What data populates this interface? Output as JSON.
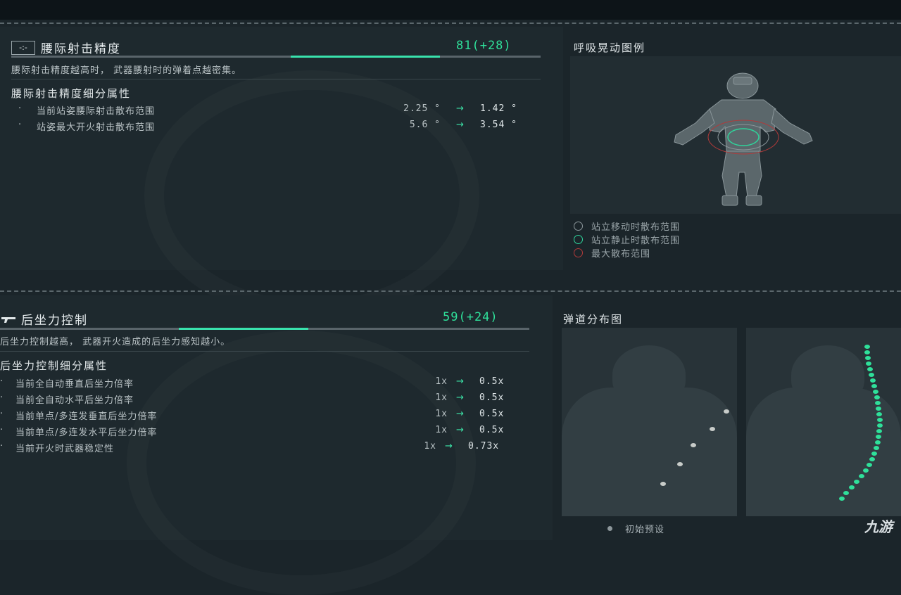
{
  "section1": {
    "icon": "crosshair-icon",
    "title": "腰际射击精度",
    "score": "81(+28)",
    "progress": {
      "base": 0.5,
      "boosted": 0.81
    },
    "description": "腰际射击精度越高时， 武器腰射时的弹着点越密集。",
    "subtitle": "腰际射击精度细分属性",
    "rows": [
      {
        "bullet": "·",
        "label": "当前站姿腰际射击散布范围",
        "old": "2.25 °",
        "arrow": "→",
        "new": "1.42 °"
      },
      {
        "bullet": "·",
        "label": "站姿最大开火射击散布范围",
        "old": "5.6 °",
        "arrow": "→",
        "new": "3.54 °"
      }
    ]
  },
  "breath_panel": {
    "title": "呼吸晃动图例",
    "figure": "soldier-figure",
    "legend": [
      {
        "label": "站立移动时散布范围",
        "color": "#8c979b"
      },
      {
        "label": "站立静止时散布范围",
        "color": "#2fd49b"
      },
      {
        "label": "最大散布范围",
        "color": "#b23a3a"
      }
    ]
  },
  "section2": {
    "icon": "rifle-icon",
    "title": "后坐力控制",
    "score": "59(+24)",
    "progress": {
      "base": 0.35,
      "boosted": 0.59
    },
    "description": "后坐力控制越高， 武器开火造成的后坐力感知越小。",
    "subtitle": "后坐力控制细分属性",
    "rows": [
      {
        "bullet": "·",
        "label": "当前全自动垂直后坐力倍率",
        "old": "1x",
        "arrow": "→",
        "new": "0.5x"
      },
      {
        "bullet": "·",
        "label": "当前全自动水平后坐力倍率",
        "old": "1x",
        "arrow": "→",
        "new": "0.5x"
      },
      {
        "bullet": "·",
        "label": "当前单点/多连发垂直后坐力倍率",
        "old": "1x",
        "arrow": "→",
        "new": "0.5x"
      },
      {
        "bullet": "·",
        "label": "当前单点/多连发水平后坐力倍率",
        "old": "1x",
        "arrow": "→",
        "new": "0.5x"
      },
      {
        "bullet": "·",
        "label": "当前开火时武器稳定性",
        "old": "1x",
        "arrow": "→",
        "new": "0.73x"
      }
    ]
  },
  "trajectory_panel": {
    "title": "弹道分布图",
    "preset_label": "初始预设",
    "colors": {
      "initial": "#c8ccc9",
      "current": "#2fe09a"
    }
  },
  "watermark": "九游",
  "colors": {
    "accent": "#2fe09a",
    "background": "#1b252a"
  }
}
